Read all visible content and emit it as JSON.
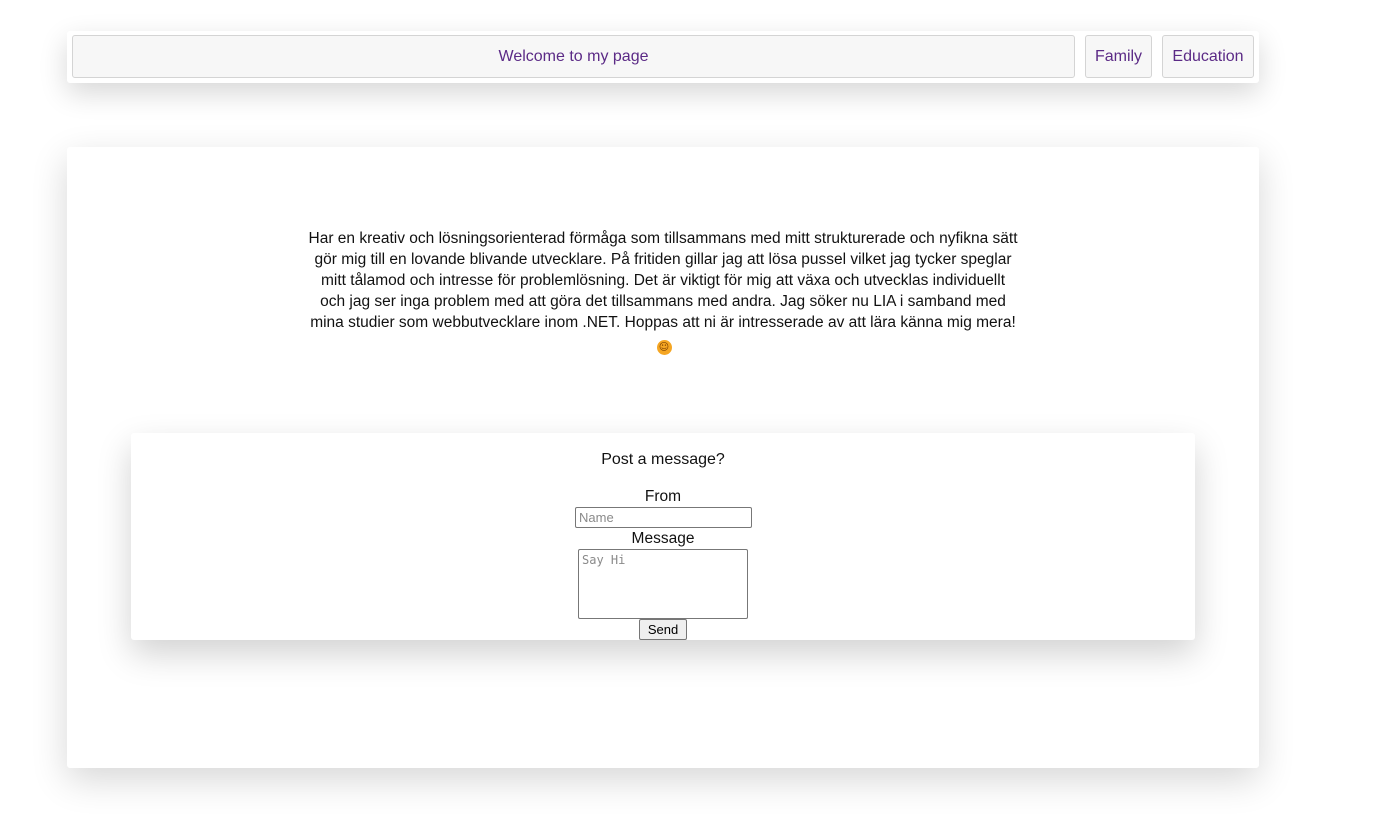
{
  "nav": {
    "home_label": "Welcome to my page",
    "family_label": "Family",
    "education_label": "Education"
  },
  "bio": {
    "text": "Har en kreativ och lösningsorienterad förmåga som tillsammans med mitt strukturerade och nyfikna sätt gör mig till en lovande blivande utvecklare. På fritiden gillar jag att lösa pussel vilket jag tycker speglar mitt tålamod och intresse för problemlösning. Det är viktigt för mig att växa och utvecklas individuellt och jag ser inga problem med att göra det tillsammans med andra. Jag söker nu LIA i samband med mina studier som webbutvecklare inom .NET. Hoppas att ni är intresserade av att lära känna mig mera!",
    "emoji": "☺"
  },
  "message_form": {
    "title": "Post a message?",
    "from_label": "From",
    "name_placeholder": "Name",
    "name_value": "",
    "message_label": "Message",
    "message_placeholder": "Say Hi",
    "message_value": "",
    "send_label": "Send"
  },
  "colors": {
    "link": "#5b2a86",
    "button_bg": "#f7f7f7",
    "emoji": "#f5a623"
  },
  "icons": {
    "emoji": "smiling-face-icon"
  }
}
